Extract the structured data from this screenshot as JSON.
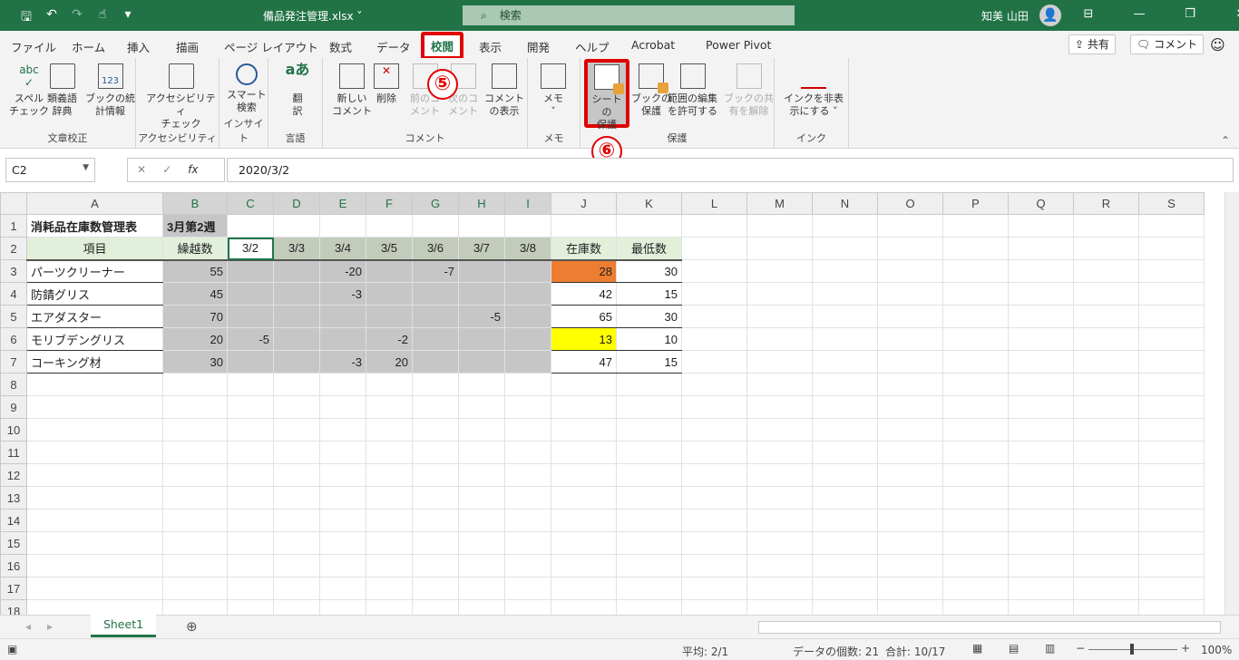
{
  "title_bar": {
    "file_name": "備品発注管理.xlsx ˅",
    "search_placeholder": "検索",
    "user_name": "知美 山田"
  },
  "menu_tabs": [
    "ファイル",
    "ホーム",
    "挿入",
    "描画",
    "ページ レイアウト",
    "数式",
    "データ",
    "校閲",
    "表示",
    "開発",
    "ヘルプ",
    "Acrobat",
    "Power Pivot"
  ],
  "active_tab": "校閲",
  "share_label": "共有",
  "comment_label": "コメント",
  "ribbon": {
    "groups": [
      "文章校正",
      "アクセシビリティ",
      "インサイト",
      "言語",
      "コメント",
      "メモ",
      "保護",
      "インク"
    ],
    "buttons": {
      "spell": [
        "スペル",
        "チェック"
      ],
      "thesaurus": [
        "類義語",
        "辞典"
      ],
      "stats": [
        "ブックの統",
        "計情報"
      ],
      "access": [
        "アクセシビリティ",
        "チェック"
      ],
      "smart": [
        "スマート",
        "検索"
      ],
      "translate": [
        "翻",
        "訳"
      ],
      "newc": [
        "新しい",
        "コメント"
      ],
      "delc": [
        "削除",
        ""
      ],
      "prevc": [
        "前のコ",
        "メント"
      ],
      "nextc": [
        "次のコ",
        "メント"
      ],
      "showc": [
        "コメント",
        "の表示"
      ],
      "memo": [
        "メモ",
        "˅"
      ],
      "protect_sheet": [
        "シートの",
        "保護"
      ],
      "protect_book": [
        "ブックの",
        "保護"
      ],
      "allow_edit": [
        "範囲の編集",
        "を許可する"
      ],
      "unshare": [
        "ブックの共",
        "有を解除"
      ],
      "hide_ink": [
        "インクを非表",
        "示にする ˅"
      ]
    }
  },
  "annotations": {
    "step5": "⑤",
    "step6": "⑥"
  },
  "formula_bar": {
    "name_box": "C2",
    "value": "2020/3/2"
  },
  "columns": [
    "A",
    "B",
    "C",
    "D",
    "E",
    "F",
    "G",
    "H",
    "I",
    "J",
    "K",
    "L",
    "M",
    "N",
    "O",
    "P",
    "Q",
    "R",
    "S"
  ],
  "rows": [
    [
      "消耗品在庫数管理表",
      "3月第2週",
      "",
      "",
      "",
      "",
      "",
      "",
      "",
      "",
      ""
    ],
    [
      "項目",
      "繰越数",
      "3/2",
      "3/3",
      "3/4",
      "3/5",
      "3/6",
      "3/7",
      "3/8",
      "在庫数",
      "最低数"
    ],
    [
      "パーツクリーナー",
      "55",
      "",
      "",
      "-20",
      "",
      "-7",
      "",
      "",
      "28",
      "30"
    ],
    [
      "防錆グリス",
      "45",
      "",
      "",
      "-3",
      "",
      "",
      "",
      "",
      "42",
      "15"
    ],
    [
      "エアダスター",
      "70",
      "",
      "",
      "",
      "",
      "",
      "-5",
      "",
      "65",
      "30"
    ],
    [
      "モリブデングリス",
      "20",
      "-5",
      "",
      "",
      "-2",
      "",
      "",
      "",
      "13",
      "10"
    ],
    [
      "コーキング材",
      "30",
      "",
      "",
      "-3",
      "20",
      "",
      "",
      "",
      "47",
      "15"
    ]
  ],
  "row_count": 18,
  "sheet_tab": "Sheet1",
  "status": {
    "average": "平均: 2/1",
    "count": "データの個数: 21",
    "sum": "合計: 10/17",
    "zoom": "100%"
  },
  "colors": {
    "brand": "#217346",
    "highlight_red": "#e00000",
    "cell_orange": "#ed7d31",
    "cell_yellow": "#ffff00",
    "cell_gray": "#c6c6c6",
    "header_green": "#e2efda"
  }
}
